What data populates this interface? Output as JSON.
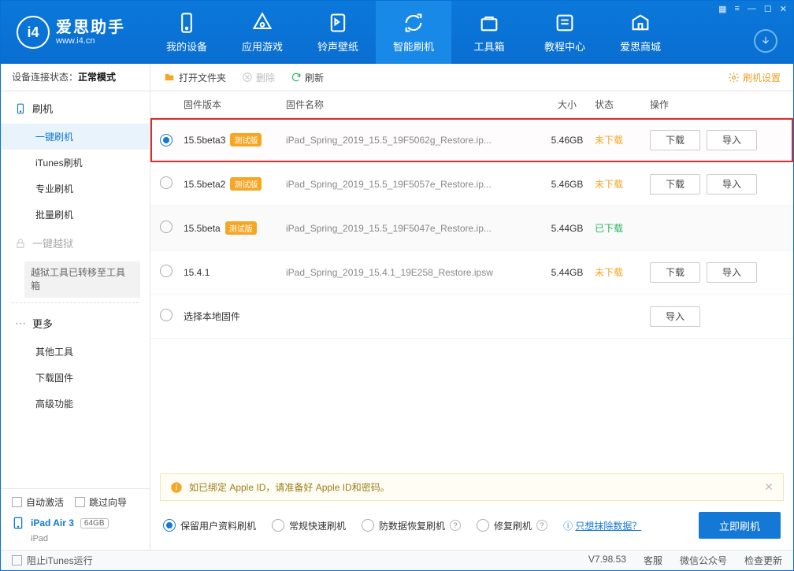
{
  "header": {
    "logo_cn": "爱思助手",
    "logo_en": "www.i4.cn",
    "tabs": [
      "我的设备",
      "应用游戏",
      "铃声壁纸",
      "智能刷机",
      "工具箱",
      "教程中心",
      "爱思商城"
    ],
    "active_tab": 3
  },
  "sidebar": {
    "status_label": "设备连接状态：",
    "status_value": "正常模式",
    "group_flash": "刷机",
    "items_flash": [
      "一键刷机",
      "iTunes刷机",
      "专业刷机",
      "批量刷机"
    ],
    "active_item": 0,
    "group_jailbreak": "一键越狱",
    "jailbreak_note": "越狱工具已转移至工具箱",
    "group_more": "更多",
    "items_more": [
      "其他工具",
      "下载固件",
      "高级功能"
    ],
    "auto_activate": "自动激活",
    "skip_guide": "跳过向导",
    "device_name": "iPad Air 3",
    "device_storage": "64GB",
    "device_type": "iPad"
  },
  "toolbar": {
    "open_folder": "打开文件夹",
    "delete": "删除",
    "refresh": "刷新",
    "settings": "刷机设置"
  },
  "table": {
    "headers": {
      "version": "固件版本",
      "name": "固件名称",
      "size": "大小",
      "status": "状态",
      "action": "操作"
    },
    "rows": [
      {
        "selected": true,
        "version": "15.5beta3",
        "beta": "测试版",
        "name": "iPad_Spring_2019_15.5_19F5062g_Restore.ip...",
        "size": "5.46GB",
        "status": "未下载",
        "status_cls": "not",
        "actions": [
          "下载",
          "导入"
        ],
        "highlight": true
      },
      {
        "selected": false,
        "version": "15.5beta2",
        "beta": "测试版",
        "name": "iPad_Spring_2019_15.5_19F5057e_Restore.ip...",
        "size": "5.46GB",
        "status": "未下载",
        "status_cls": "not",
        "actions": [
          "下载",
          "导入"
        ]
      },
      {
        "selected": false,
        "version": "15.5beta",
        "beta": "测试版",
        "name": "iPad_Spring_2019_15.5_19F5047e_Restore.ip...",
        "size": "5.44GB",
        "status": "已下载",
        "status_cls": "done",
        "actions": [],
        "alt": true
      },
      {
        "selected": false,
        "version": "15.4.1",
        "beta": "",
        "name": "iPad_Spring_2019_15.4.1_19E258_Restore.ipsw",
        "size": "5.44GB",
        "status": "未下载",
        "status_cls": "not",
        "actions": [
          "下载",
          "导入"
        ]
      },
      {
        "selected": false,
        "version": "选择本地固件",
        "beta": "",
        "name": "",
        "size": "",
        "status": "",
        "status_cls": "",
        "actions": [
          "导入"
        ]
      }
    ]
  },
  "notice": {
    "text": "如已绑定 Apple ID，请准备好 Apple ID和密码。"
  },
  "flashbar": {
    "opts": [
      "保留用户资料刷机",
      "常规快速刷机",
      "防数据恢复刷机",
      "修复刷机"
    ],
    "opt_selected": 0,
    "link": "只想抹除数据？",
    "primary": "立即刷机"
  },
  "statusbar": {
    "block_itunes": "阻止iTunes运行",
    "version": "V7.98.53",
    "right": [
      "客服",
      "微信公众号",
      "检查更新"
    ]
  }
}
